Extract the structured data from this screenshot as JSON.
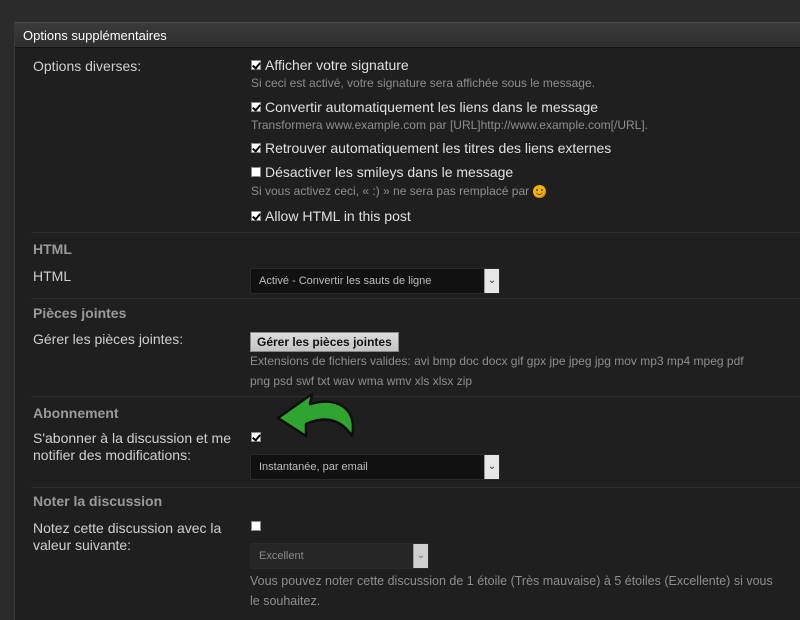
{
  "panel": {
    "title": "Options supplémentaires"
  },
  "misc": {
    "label": "Options diverses:",
    "signature": {
      "label": "Afficher votre signature",
      "hint": "Si ceci est activé, votre signature sera affichée sous le message.",
      "checked": true
    },
    "links": {
      "label": "Convertir automatiquement les liens dans le message",
      "hint": "Transformera www.example.com par [URL]http://www.example.com[/URL].",
      "checked": true
    },
    "titles": {
      "label": "Retrouver automatiquement les titres des liens externes",
      "checked": true
    },
    "smileys": {
      "label": "Désactiver les smileys dans le message",
      "hint": "Si vous activez ceci, « :) » ne sera pas remplacé par",
      "checked": false
    },
    "html": {
      "label": "Allow HTML in this post",
      "checked": true
    }
  },
  "html_section": {
    "title": "HTML",
    "label": "HTML",
    "select_value": "Activé - Convertir les sauts de ligne"
  },
  "attachments": {
    "title": "Pièces jointes",
    "label": "Gérer les pièces jointes:",
    "button": "Gérer les pièces jointes",
    "extensions_line1": "Extensions de fichiers valides: avi bmp doc docx gif gpx jpe jpeg jpg mov mp3 mp4 mpeg pdf",
    "extensions_line2": "png psd swf txt wav wma wmv xls xlsx zip"
  },
  "subscription": {
    "title": "Abonnement",
    "label_line1": "S'abonner à la discussion et me",
    "label_line2": "notifier des modifications:",
    "checked": true,
    "select_value": "Instantanée, par email"
  },
  "rating": {
    "title": "Noter la discussion",
    "label_line1": "Notez cette discussion avec la",
    "label_line2": "valeur suivante:",
    "checked": false,
    "select_value": "Excellent",
    "hint_line1": "Vous pouvez noter cette discussion de 1 étoile (Très mauvaise) à 5 étoiles (Excellente) si vous",
    "hint_line2": "le souhaitez."
  },
  "colors": {
    "panel": "#1f1f1f",
    "header": "#3a3a3a",
    "arrow": "#2fa52f"
  },
  "icons": {
    "chevron": "chevron-down-icon",
    "smiley": "smiley-icon",
    "arrow": "curved-arrow-icon"
  }
}
